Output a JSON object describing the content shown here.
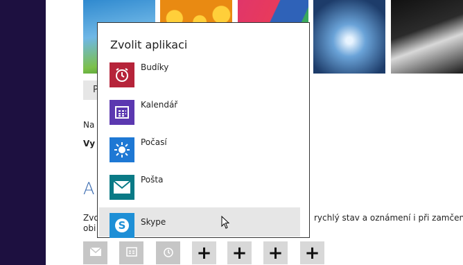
{
  "background": {
    "button_label": "P",
    "text_na": "Na",
    "text_vy": "Vy",
    "heading_letter": "A",
    "text_zvo": "Zvo",
    "text_obi": "obi",
    "text_right": "rychlý stav a oznámení i při zamčené"
  },
  "popup": {
    "title": "Zvolit aplikaci",
    "apps": [
      {
        "label": "Budíky",
        "color": "#b6243a",
        "icon": "alarm-clock-icon"
      },
      {
        "label": "Kalendář",
        "color": "#5b38b0",
        "icon": "calendar-icon"
      },
      {
        "label": "Počasí",
        "color": "#1e78d4",
        "icon": "sun-icon"
      },
      {
        "label": "Pošta",
        "color": "#0a7a86",
        "icon": "envelope-icon"
      },
      {
        "label": "Skype",
        "color": "#1e8fd6",
        "icon": "skype-icon"
      }
    ],
    "selected_index": 4
  },
  "quick_status": {
    "slots": [
      {
        "type": "filled",
        "icon": "envelope-icon"
      },
      {
        "type": "filled",
        "icon": "calendar-icon"
      },
      {
        "type": "filled",
        "icon": "alarm-clock-icon"
      },
      {
        "type": "empty",
        "label": "+"
      },
      {
        "type": "empty",
        "label": "+"
      },
      {
        "type": "empty",
        "label": "+"
      },
      {
        "type": "empty",
        "label": "+"
      }
    ]
  }
}
